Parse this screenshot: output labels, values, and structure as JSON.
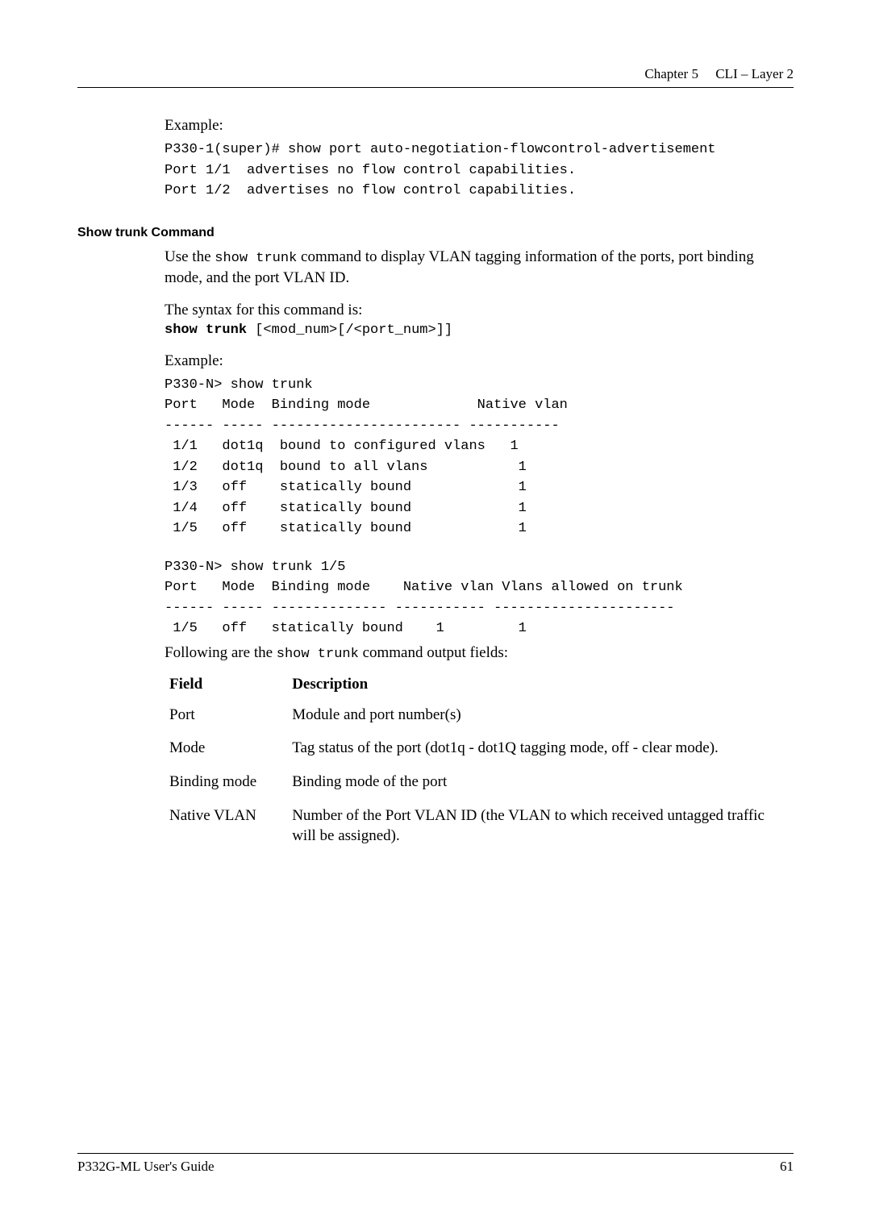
{
  "header": {
    "chapter": "Chapter 5",
    "title": "CLI – Layer 2"
  },
  "example1": {
    "label": "Example:",
    "code": "P330-1(super)# show port auto-negotiation-flowcontrol-advertisement\nPort 1/1  advertises no flow control capabilities.\nPort 1/2  advertises no flow control capabilities."
  },
  "show_trunk": {
    "heading": "Show trunk Command",
    "intro_pre": "Use the ",
    "intro_cmd": "show trunk",
    "intro_post": " command to display VLAN tagging information of the ports, port binding mode, and the port VLAN ID.",
    "syntax_label": "The syntax for this command is:",
    "syntax_bold": "show trunk",
    "syntax_plain": " [<mod_num>[/<port_num>]]",
    "example_label": "Example:",
    "code1": "P330-N> show trunk\nPort   Mode  Binding mode             Native vlan\n------ ----- ----------------------- -----------\n 1/1   dot1q  bound to configured vlans   1\n 1/2   dot1q  bound to all vlans           1\n 1/3   off    statically bound             1\n 1/4   off    statically bound             1\n 1/5   off    statically bound             1",
    "code2": "P330-N> show trunk 1/5\nPort   Mode  Binding mode    Native vlan Vlans allowed on trunk\n------ ----- -------------- ----------- ----------------------\n 1/5   off   statically bound    1         1",
    "following_pre": "Following are the ",
    "following_cmd": "show trunk",
    "following_post": " command output fields:"
  },
  "fields_table": {
    "head_field": "Field",
    "head_desc": "Description",
    "rows": [
      {
        "field": "Port",
        "desc": "Module and port number(s)"
      },
      {
        "field": "Mode",
        "desc": "Tag status of the port (dot1q - dot1Q tagging mode, off - clear mode)."
      },
      {
        "field": "Binding mode",
        "desc": "Binding mode of the port"
      },
      {
        "field": "Native VLAN",
        "desc": "Number of the Port VLAN ID (the VLAN to which received untagged traffic will be assigned)."
      }
    ]
  },
  "footer": {
    "left": "P332G-ML User's Guide",
    "right": "61"
  }
}
